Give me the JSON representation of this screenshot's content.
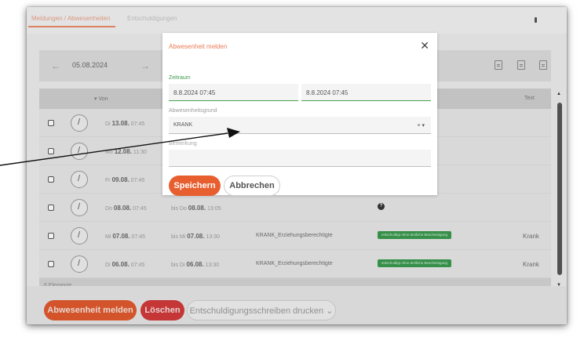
{
  "top_tabs": {
    "active": "Meldungen / Abwesenheiten",
    "second": "Entschuldigungen"
  },
  "datebar": {
    "prev": "←",
    "date": "05.08.2024",
    "next": "→"
  },
  "table": {
    "header_von": "▾ Von",
    "header_text": "Text",
    "rows": [
      {
        "from_day": "Di",
        "from_date": "13.08.",
        "from_time": "07:45",
        "to_day": "",
        "to_date": "",
        "to_time": "",
        "reason": "",
        "status": "",
        "type": ""
      },
      {
        "from_day": "Mo",
        "from_date": "12.08.",
        "from_time": "11:30",
        "to_day": "",
        "to_date": "",
        "to_time": "",
        "reason": "",
        "status": "",
        "type": ""
      },
      {
        "from_day": "Fr",
        "from_date": "09.08.",
        "from_time": "07:45",
        "to_day": "",
        "to_date": "",
        "to_time": "",
        "reason": "",
        "status": "",
        "type": ""
      },
      {
        "from_day": "Do",
        "from_date": "08.08.",
        "from_time": "07:45",
        "to_day": "bis Do",
        "to_date": "08.08.",
        "to_time": "13:05",
        "reason": "",
        "status": "?",
        "type": ""
      },
      {
        "from_day": "Mi",
        "from_date": "07.08.",
        "from_time": "07:45",
        "to_day": "bis Mi",
        "to_date": "07.08.",
        "to_time": "13:30",
        "reason": "KRANK_Erziehungsberechtigte",
        "status": "entschuldigt ohne ärztliche Bescheinigung",
        "type": "Krank"
      },
      {
        "from_day": "Di",
        "from_date": "06.08.",
        "from_time": "07:45",
        "to_day": "bis Di",
        "to_date": "06.08.",
        "to_time": "13:30",
        "reason": "KRANK_Erziehungsberechtigte",
        "status": "entschuldigt ohne ärztliche Bescheinigung",
        "type": "Krank"
      }
    ],
    "count": "6 Elemente"
  },
  "buttons": {
    "report": "Abwesenheit melden",
    "delete": "Löschen",
    "print": "Entschuldigungsschreiben drucken ⌄"
  },
  "modal": {
    "title": "Abwesenheit melden",
    "close": "✕",
    "zeitraum_label": "Zeitraum",
    "from_value": "8.8.2024 07:45",
    "to_value": "8.8.2024 07:45",
    "grund_label": "Abwesenheitsgrund",
    "grund_value": "KRANK",
    "grund_controls": "× ▾",
    "bemerkung_label": "Bemerkung",
    "bemerkung_value": "",
    "save": "Speichern",
    "cancel": "Abbrechen"
  },
  "colors": {
    "accent": "#e85f2f",
    "danger": "#d23a3a",
    "success": "#3a9a4e",
    "annotation": "#111111"
  }
}
